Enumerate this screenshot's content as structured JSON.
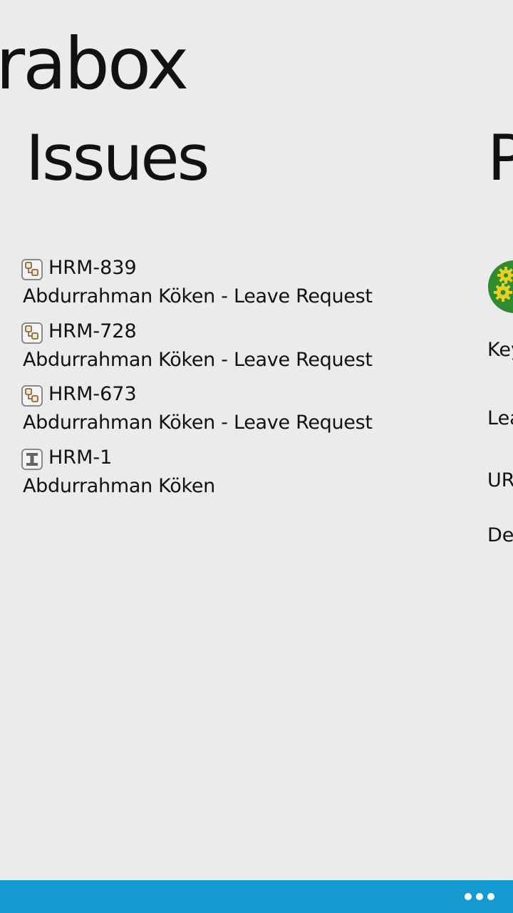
{
  "header": {
    "app_title": "rabox",
    "section_title": "Issues",
    "next_section_title": "P"
  },
  "issues": [
    {
      "key": "HRM-839",
      "summary": "Abdurrahman Köken - Leave Request",
      "type_icon": "subtask-icon"
    },
    {
      "key": "HRM-728",
      "summary": "Abdurrahman Köken - Leave Request",
      "type_icon": "subtask-icon"
    },
    {
      "key": "HRM-673",
      "summary": "Abdurrahman Köken - Leave Request",
      "type_icon": "subtask-icon"
    },
    {
      "key": "HRM-1",
      "summary": "Abdurrahman Köken",
      "type_icon": "improvement-icon"
    }
  ],
  "peek_panel": {
    "avatar_icon": "project-gears-icon",
    "labels": [
      "Key",
      "Lea",
      "UR",
      "De"
    ]
  },
  "app_bar": {
    "more_icon": "ellipsis-icon",
    "color": "#1499d0"
  },
  "colors": {
    "background": "#ebebeb",
    "text": "#111111",
    "accent": "#1499d0",
    "avatar_green": "#2e8b2e",
    "gear_yellow": "#e8d020"
  }
}
